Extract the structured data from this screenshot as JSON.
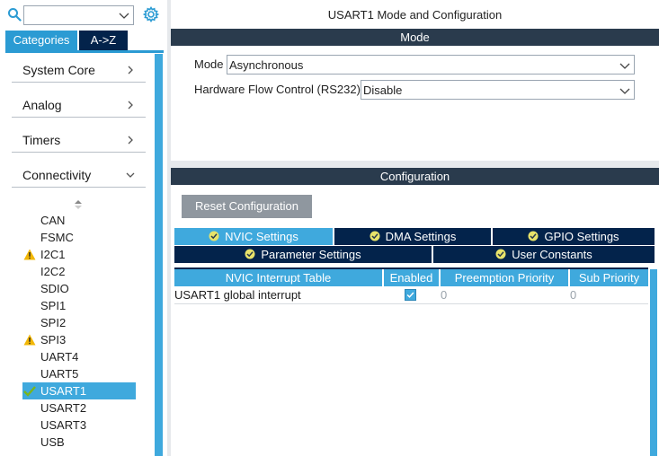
{
  "left": {
    "search": {
      "value": ""
    },
    "tabs": [
      {
        "label": "Categories",
        "active": true
      },
      {
        "label": "A->Z",
        "active": false
      }
    ],
    "categories": [
      {
        "label": "System Core",
        "expanded": false
      },
      {
        "label": "Analog",
        "expanded": false
      },
      {
        "label": "Timers",
        "expanded": false
      },
      {
        "label": "Connectivity",
        "expanded": true
      }
    ],
    "peripherals": [
      {
        "label": "CAN",
        "status": "none"
      },
      {
        "label": "FSMC",
        "status": "none"
      },
      {
        "label": "I2C1",
        "status": "warning"
      },
      {
        "label": "I2C2",
        "status": "none"
      },
      {
        "label": "SDIO",
        "status": "none"
      },
      {
        "label": "SPI1",
        "status": "none"
      },
      {
        "label": "SPI2",
        "status": "none"
      },
      {
        "label": "SPI3",
        "status": "warning"
      },
      {
        "label": "UART4",
        "status": "none"
      },
      {
        "label": "UART5",
        "status": "none"
      },
      {
        "label": "USART1",
        "status": "ok",
        "selected": true
      },
      {
        "label": "USART2",
        "status": "none"
      },
      {
        "label": "USART3",
        "status": "none"
      },
      {
        "label": "USB",
        "status": "none"
      }
    ]
  },
  "right": {
    "title": "USART1 Mode and Configuration",
    "mode_header": "Mode",
    "mode_label": "Mode",
    "mode_value": "Asynchronous",
    "flow_label": "Hardware Flow Control (RS232)",
    "flow_value": "Disable",
    "config_header": "Configuration",
    "reset_label": "Reset Configuration",
    "tabs_row1": [
      {
        "label": "NVIC Settings",
        "active": true
      },
      {
        "label": "DMA Settings",
        "active": false
      },
      {
        "label": "GPIO Settings",
        "active": false
      }
    ],
    "tabs_row2": [
      {
        "label": "Parameter Settings",
        "active": false
      },
      {
        "label": "User Constants",
        "active": false
      }
    ],
    "table": {
      "headers": [
        "NVIC Interrupt Table",
        "Enabled",
        "Preemption Priority",
        "Sub Priority"
      ],
      "rows": [
        {
          "name": "USART1 global interrupt",
          "enabled": true,
          "preemption": "0",
          "sub": "0"
        }
      ]
    }
  },
  "colors": {
    "accent": "#3fa9dd",
    "navy": "#03234b",
    "header_bar": "#2a3b4d",
    "button_gray": "#8f979f",
    "warning": "#f2b705",
    "ok": "#7ab51d"
  }
}
